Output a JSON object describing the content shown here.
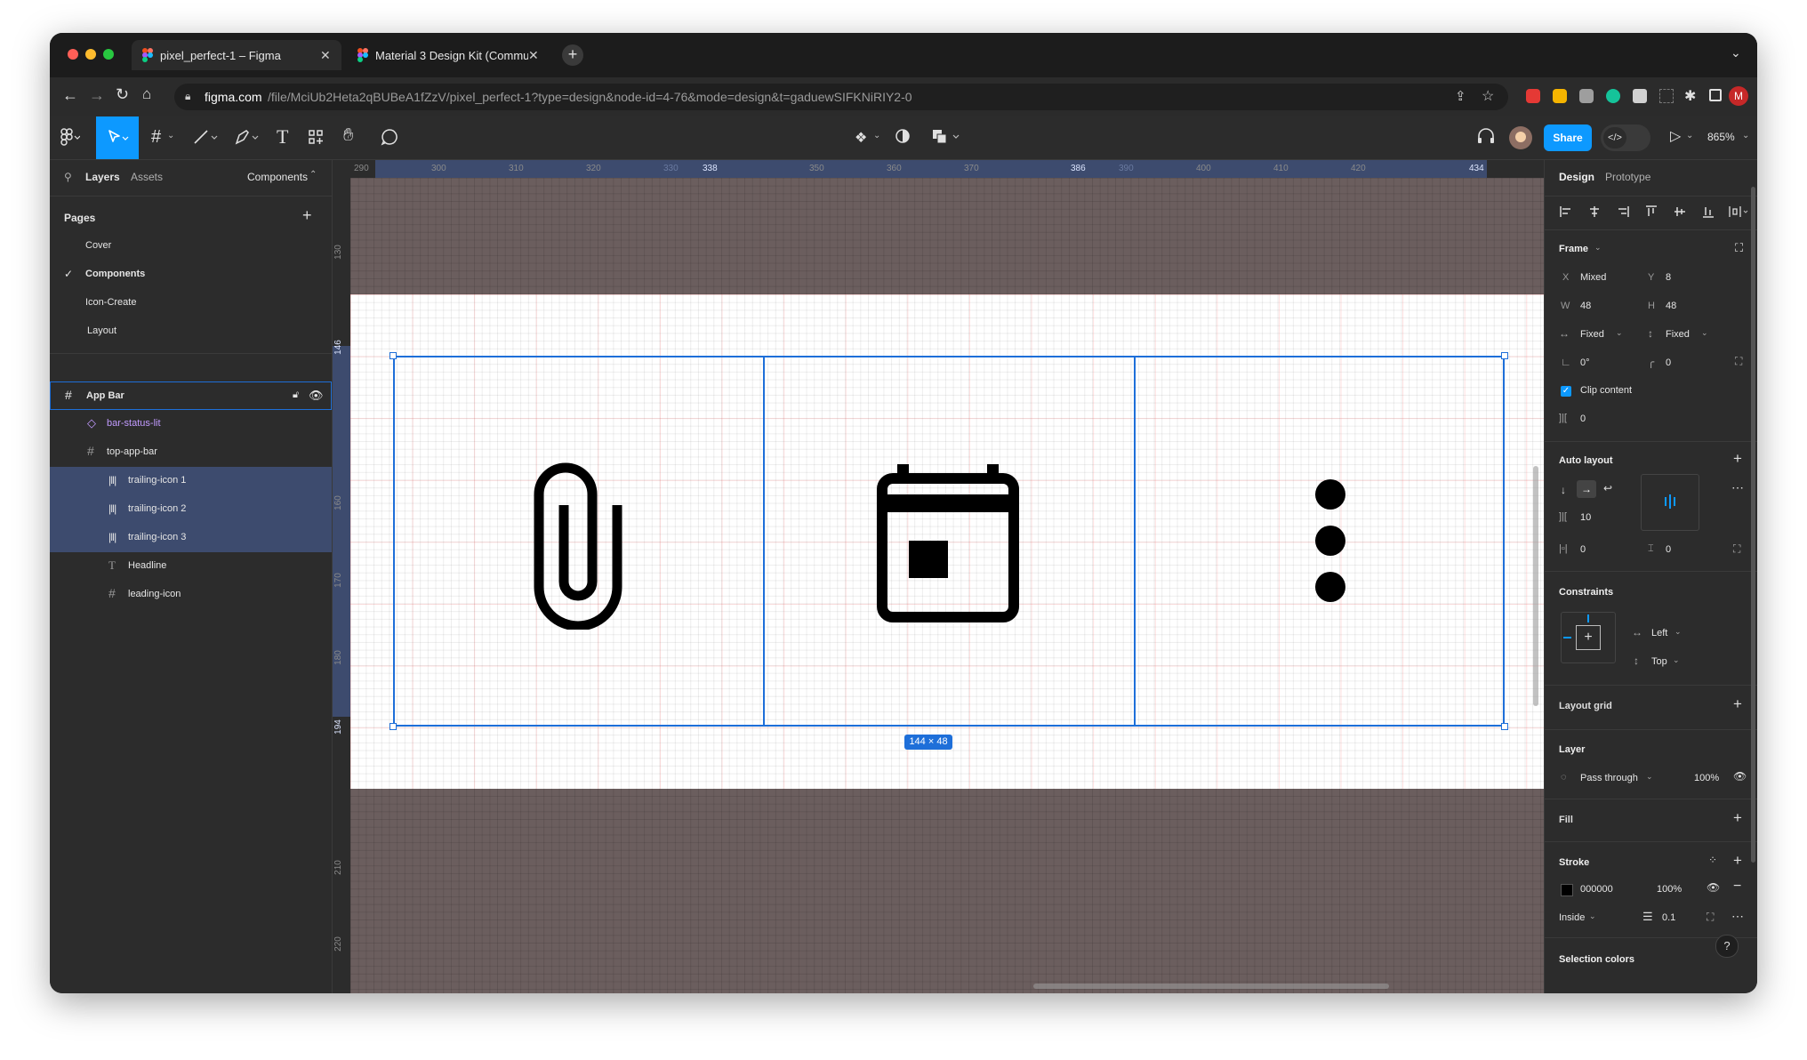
{
  "browser": {
    "tabs": [
      {
        "title": "pixel_perfect-1 – Figma",
        "active": true
      },
      {
        "title": "Material 3 Design Kit (Commu",
        "active": false
      }
    ],
    "url_host": "figma.com",
    "url_path": "/file/MciUb2Heta2qBUBeA1fZzV/pixel_perfect-1?type=design&node-id=4-76&mode=design&t=gaduewSIFKNiRIY2-0",
    "avatar_letter": "M"
  },
  "toolbar": {
    "share_label": "Share",
    "zoom": "865%"
  },
  "left_panel": {
    "tabs": {
      "layers": "Layers",
      "assets": "Assets",
      "components": "Components"
    },
    "pages_title": "Pages",
    "pages": [
      "Cover",
      "Components",
      "Icon-Create",
      "Layout"
    ],
    "current_page": "Components",
    "layers": [
      {
        "name": "App Bar",
        "type": "frame",
        "selected_parent": true
      },
      {
        "name": "bar-status-lit",
        "type": "instance"
      },
      {
        "name": "top-app-bar",
        "type": "frame"
      },
      {
        "name": "trailing-icon 1",
        "type": "autolayout",
        "selected": true
      },
      {
        "name": "trailing-icon 2",
        "type": "autolayout",
        "selected": true
      },
      {
        "name": "trailing-icon 3",
        "type": "autolayout",
        "selected": true
      },
      {
        "name": "Headline",
        "type": "text"
      },
      {
        "name": "leading-icon",
        "type": "frame"
      }
    ]
  },
  "rulers": {
    "top": [
      "290",
      "300",
      "310",
      "320",
      "330",
      "338",
      "350",
      "360",
      "370",
      "386",
      "390",
      "400",
      "410",
      "420",
      "434"
    ],
    "left": [
      "130",
      "146",
      "160",
      "170",
      "180",
      "194",
      "210",
      "220"
    ]
  },
  "canvas": {
    "dimension_badge": "144 × 48",
    "icons": [
      "attach-icon",
      "calendar-icon",
      "more-vert-icon"
    ]
  },
  "right_panel": {
    "tabs": {
      "design": "Design",
      "prototype": "Prototype"
    },
    "frame": {
      "title": "Frame",
      "x_label": "X",
      "x": "Mixed",
      "y_label": "Y",
      "y": "8",
      "w_label": "W",
      "w": "48",
      "h_label": "H",
      "h": "48",
      "w_mode": "Fixed",
      "h_mode": "Fixed",
      "rotation": "0°",
      "radius": "0",
      "clip_content": "Clip content",
      "spacing": "0"
    },
    "auto_layout": {
      "title": "Auto layout",
      "gap": "10",
      "padding_h": "0",
      "padding_v": "0"
    },
    "constraints": {
      "title": "Constraints",
      "horizontal": "Left",
      "vertical": "Top"
    },
    "layout_grid": {
      "title": "Layout grid"
    },
    "layer": {
      "title": "Layer",
      "blend": "Pass through",
      "opacity": "100%"
    },
    "fill": {
      "title": "Fill"
    },
    "stroke": {
      "title": "Stroke",
      "color": "000000",
      "opacity": "100%",
      "position": "Inside",
      "weight": "0.1"
    },
    "selection_colors": {
      "title": "Selection colors"
    },
    "help": "?"
  },
  "colors": {
    "accent": "#0d99ff",
    "selection": "#1e6fd9",
    "layer_highlight": "#3d4b6e",
    "canvas_bg": "#6b5e5e",
    "panel_bg": "#2c2c2c",
    "instance_purple": "#c29bff"
  }
}
